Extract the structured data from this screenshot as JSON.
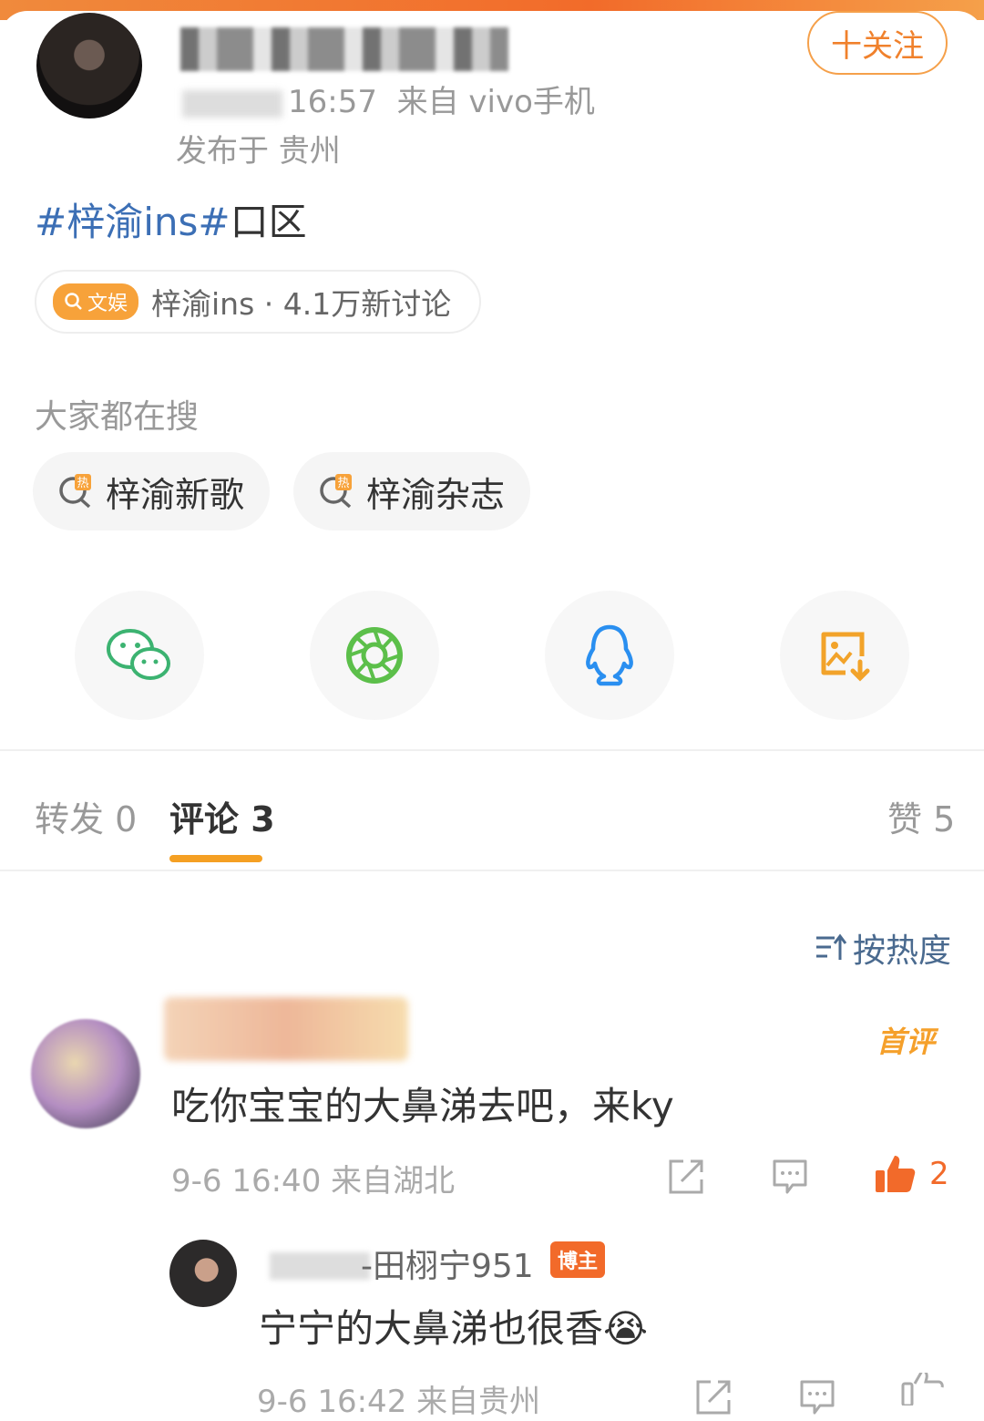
{
  "post": {
    "time_partial": "16:57",
    "source": "来自 vivo手机",
    "location": "发布于 贵州",
    "follow_label": "十关注",
    "hashtag": "#梓渝ins#",
    "text": "口区"
  },
  "topic": {
    "badge": "文娱",
    "label": "梓渝ins · 4.1万新讨论"
  },
  "hot_search": {
    "title": "大家都在搜",
    "items": [
      "梓渝新歌",
      "梓渝杂志"
    ]
  },
  "share": {
    "icons": [
      "wechat-icon",
      "moments-icon",
      "qq-icon",
      "save-image-icon"
    ]
  },
  "tabs": {
    "repost": "转发 0",
    "comments": "评论 3",
    "likes": "赞 5"
  },
  "sort_label": "按热度",
  "comment": {
    "first_label": "首评",
    "text": "吃你宝宝的大鼻涕去吧，来ky",
    "meta": "9-6 16:40  来自湖北",
    "like_count": "2"
  },
  "reply": {
    "name": "-田栩宁951",
    "badge": "博主",
    "text": "宁宁的大鼻涕也很香😭",
    "meta": "9-6 16:42  来自贵州"
  },
  "colors": {
    "accent_orange": "#f5a023",
    "link_blue": "#3c6fb5"
  }
}
